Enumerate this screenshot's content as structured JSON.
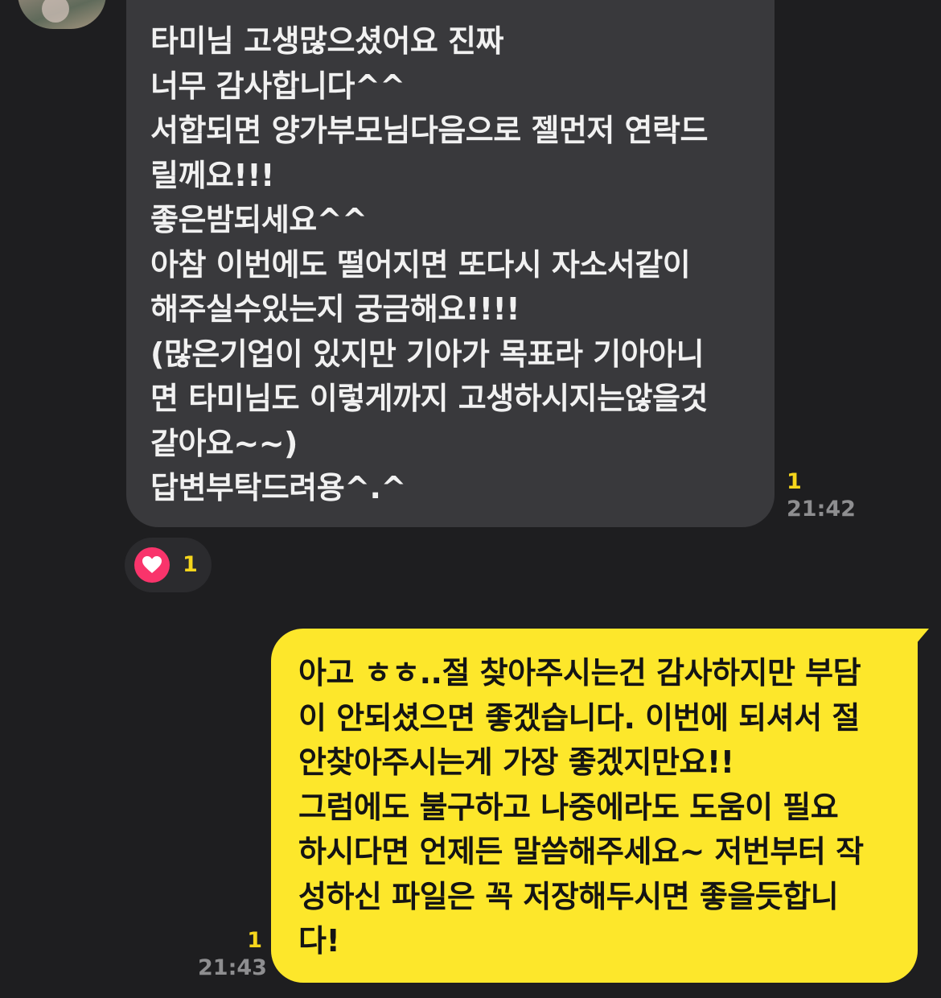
{
  "incoming": {
    "text": "타미님 고생많으셨어요 진짜\n너무 감사합니다^^\n서합되면 양가부모님다음으로 젤먼저 연락드\n릴께요!!!\n좋은밤되세요^^\n아참 이번에도 떨어지면 또다시 자소서같이\n해주실수있는지 궁금해요!!!!\n(많은기업이 있지만 기아가 목표라 기아아니\n면 타미님도 이렇게까지 고생하시지는않을것\n같아요~~)\n답변부탁드려용^.^",
    "unread": "1",
    "time": "21:42"
  },
  "reaction": {
    "icon": "heart-icon",
    "count": "1",
    "color": "#f9346b"
  },
  "outgoing": {
    "text": "아고 ㅎㅎ..절 찾아주시는건 감사하지만 부담\n이 안되셨으면 좋겠습니다. 이번에 되셔서 절\n안찾아주시는게 가장 좋겠지만요!!\n그럼에도 불구하고 나중에라도 도움이 필요\n하시다면 언제든 말씀해주세요~ 저번부터 작\n성하신 파일은 꼭 저장해두시면 좋을듯합니\n다!",
    "unread": "1",
    "time": "21:43"
  },
  "colors": {
    "background": "#1e1e20",
    "incoming_bubble": "#39393c",
    "outgoing_bubble": "#fde72b",
    "unread": "#f6d61c",
    "time": "#8e8e90"
  }
}
